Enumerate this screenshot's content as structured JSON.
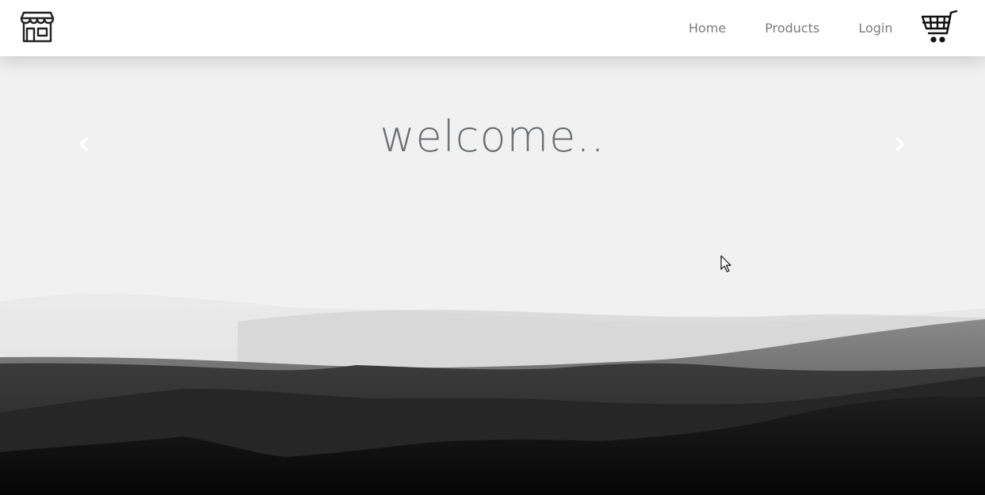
{
  "navbar": {
    "logo_icon": "storefront-icon",
    "links": {
      "home": "Home",
      "products": "Products",
      "login": "Login"
    },
    "cart_icon": "shopping-cart-icon"
  },
  "hero": {
    "title": "welcome..",
    "prev_icon": "chevron-left-icon",
    "next_icon": "chevron-right-icon"
  },
  "colors": {
    "nav_bg": "#ffffff",
    "nav_text": "#7b7b7b",
    "hero_bg": "#f1f1f1",
    "title_text": "#6c7173",
    "mountain_dark": "#0a0a0a"
  }
}
